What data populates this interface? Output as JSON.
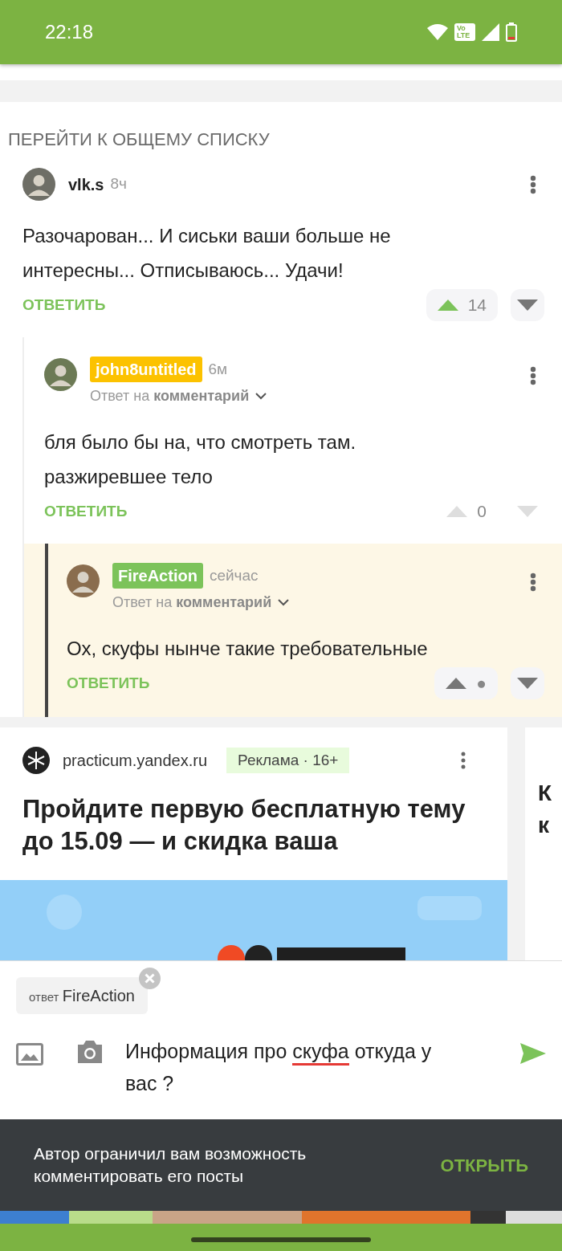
{
  "status_bar": {
    "time": "22:18",
    "network_badge": "Vo LTE"
  },
  "back_link": "ПЕРЕЙТИ К ОБЩЕМУ СПИСКУ",
  "comments": [
    {
      "author": "vlk.s",
      "time": "8ч",
      "text": "Разочарован... И сиськи ваши больше не интересны... Отписываюсь... Удачи!",
      "reply": "ОТВЕТИТЬ",
      "score": "14",
      "voted_up": true,
      "voting_enabled": true,
      "highlighted": false,
      "children": [
        {
          "author": "john8untitled",
          "color": "#fcc200",
          "time": "6м",
          "reply_to_prefix": "Ответ на",
          "reply_to": "комментарий",
          "text": "бля было бы на, что смотреть там. разжиревшее тело",
          "reply": "ОТВЕТИТЬ",
          "score": "0",
          "voted_up": false,
          "voting_enabled": false,
          "highlighted": false,
          "children": [
            {
              "author": "FireAction",
              "color": "#7cc35a",
              "time": "сейчас",
              "reply_to_prefix": "Ответ на",
              "reply_to": "комментарий",
              "text": "Ох, скуфы нынче такие требовательные",
              "reply": "ОТВЕТИТЬ",
              "score": "●",
              "voted_up": false,
              "voting_enabled": true,
              "highlighted": true
            }
          ]
        }
      ]
    }
  ],
  "ad": {
    "domain": "practicum.yandex.ru",
    "label": "Реклама · 16+",
    "title": "Пройдите первую бесплатную тему до 15.09 — и скидка ваша"
  },
  "next_ad": {
    "title": "К к"
  },
  "reply_form": {
    "reply_prefix": "ответ",
    "reply_to": "FireAction",
    "value_parts": [
      {
        "text": "Информация про ",
        "misspelled": false
      },
      {
        "text": "скуфа",
        "misspelled": true
      },
      {
        "text": " откуда у вас ?",
        "misspelled": false
      }
    ]
  },
  "snackbar": {
    "message": "Автор ограничил вам возможность комментировать его посты",
    "action": "ОТКРЫТЬ"
  }
}
